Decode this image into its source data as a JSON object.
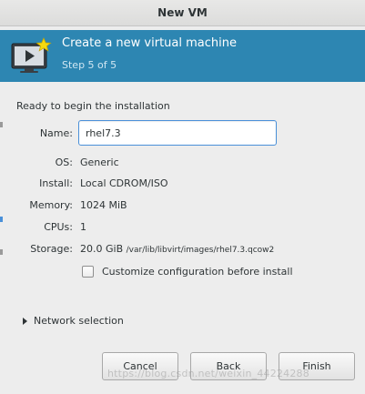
{
  "window": {
    "title": "New VM"
  },
  "banner": {
    "title": "Create a new virtual machine",
    "step": "Step 5 of 5",
    "icon": "monitor-play-star-icon",
    "background": "#2d86b2"
  },
  "summary": {
    "heading": "Ready to begin the installation",
    "name_label": "Name:",
    "name_value": "rhel7.3",
    "os_label": "OS:",
    "os_value": "Generic",
    "install_label": "Install:",
    "install_value": "Local CDROM/ISO",
    "memory_label": "Memory:",
    "memory_value": "1024 MiB",
    "cpus_label": "CPUs:",
    "cpus_value": "1",
    "storage_label": "Storage:",
    "storage_value": "20.0 GiB",
    "storage_path": "/var/lib/libvirt/images/rhel7.3.qcow2"
  },
  "customize": {
    "label": "Customize configuration before install",
    "checked": false
  },
  "network": {
    "label": "Network selection"
  },
  "buttons": {
    "cancel": "Cancel",
    "back": "Back",
    "finish": "Finish"
  },
  "watermark": "https://blog.csdn.net/weixin_44224288",
  "colors": {
    "accent": "#4a90d9",
    "dialog_bg": "#ededed"
  }
}
